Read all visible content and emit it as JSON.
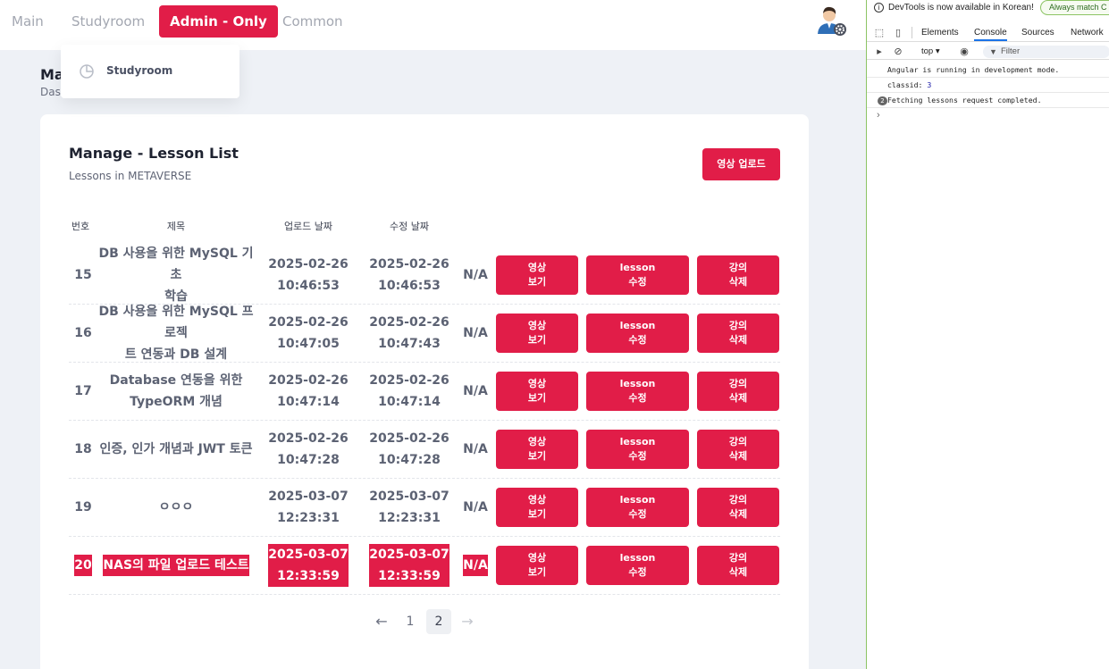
{
  "nav": {
    "tabs": [
      {
        "label": "Main"
      },
      {
        "label": "Studyroom"
      },
      {
        "label": "Admin - Only"
      },
      {
        "label": "Common"
      }
    ],
    "active_tab": "Admin - Only",
    "dropdown": {
      "items": [
        {
          "label": "Studyroom",
          "icon": "pie-chart-icon"
        }
      ]
    }
  },
  "page": {
    "title_visible": "Ma",
    "subtitle_visible": "Das"
  },
  "card": {
    "title": "Manage - Lesson List",
    "subtitle": "Lessons in METAVERSE",
    "upload_button": "영상 업로드",
    "headers": {
      "no": "번호",
      "title": "제목",
      "uploaded": "업로드 날짜",
      "modified": "수정 날짜"
    },
    "button_labels": {
      "view": "영상\n보기",
      "edit": "lesson\n수정",
      "delete": "강의\n삭제"
    },
    "rows": [
      {
        "no": "15",
        "title": "DB 사용을 위한 MySQL 기초\n학습",
        "uploaded": "2025-02-26\n10:46:53",
        "modified": "2025-02-26\n10:46:53",
        "status": "N/A",
        "highlighted": false
      },
      {
        "no": "16",
        "title": "DB 사용을 위한 MySQL 프로젝\n트 연동과 DB 설계",
        "uploaded": "2025-02-26\n10:47:05",
        "modified": "2025-02-26\n10:47:43",
        "status": "N/A",
        "highlighted": false
      },
      {
        "no": "17",
        "title": "Database 연동을 위한\nTypeORM 개념",
        "uploaded": "2025-02-26\n10:47:14",
        "modified": "2025-02-26\n10:47:14",
        "status": "N/A",
        "highlighted": false
      },
      {
        "no": "18",
        "title": "인증, 인가 개념과 JWT 토큰",
        "uploaded": "2025-02-26\n10:47:28",
        "modified": "2025-02-26\n10:47:28",
        "status": "N/A",
        "highlighted": false
      },
      {
        "no": "19",
        "title": "ㅇㅇㅇ",
        "uploaded": "2025-03-07\n12:23:31",
        "modified": "2025-03-07\n12:23:31",
        "status": "N/A",
        "highlighted": false
      },
      {
        "no": "20",
        "title": "NAS의 파일 업로드 테스트",
        "uploaded": "2025-03-07\n12:33:59",
        "modified": "2025-03-07\n12:33:59",
        "status": "N/A",
        "highlighted": true
      }
    ],
    "pagination": {
      "prev": "←",
      "pages": [
        "1",
        "2"
      ],
      "current": "2",
      "next": "→"
    }
  },
  "devtools": {
    "info_text": "DevTools is now available in Korean!",
    "match_button": "Always match C",
    "tabs": [
      "Elements",
      "Console",
      "Sources",
      "Network"
    ],
    "active_tab": "Console",
    "context": "top ▾",
    "filter_placeholder": "Filter",
    "console": [
      {
        "text": "Angular is running in development mode."
      },
      {
        "text_prefix": "classid: ",
        "value": "3"
      },
      {
        "count": "2",
        "text": "Fetching lessons request completed."
      }
    ],
    "prompt": "›"
  },
  "colors": {
    "accent": "#e11d48",
    "devtools_border": "#8cc464"
  }
}
